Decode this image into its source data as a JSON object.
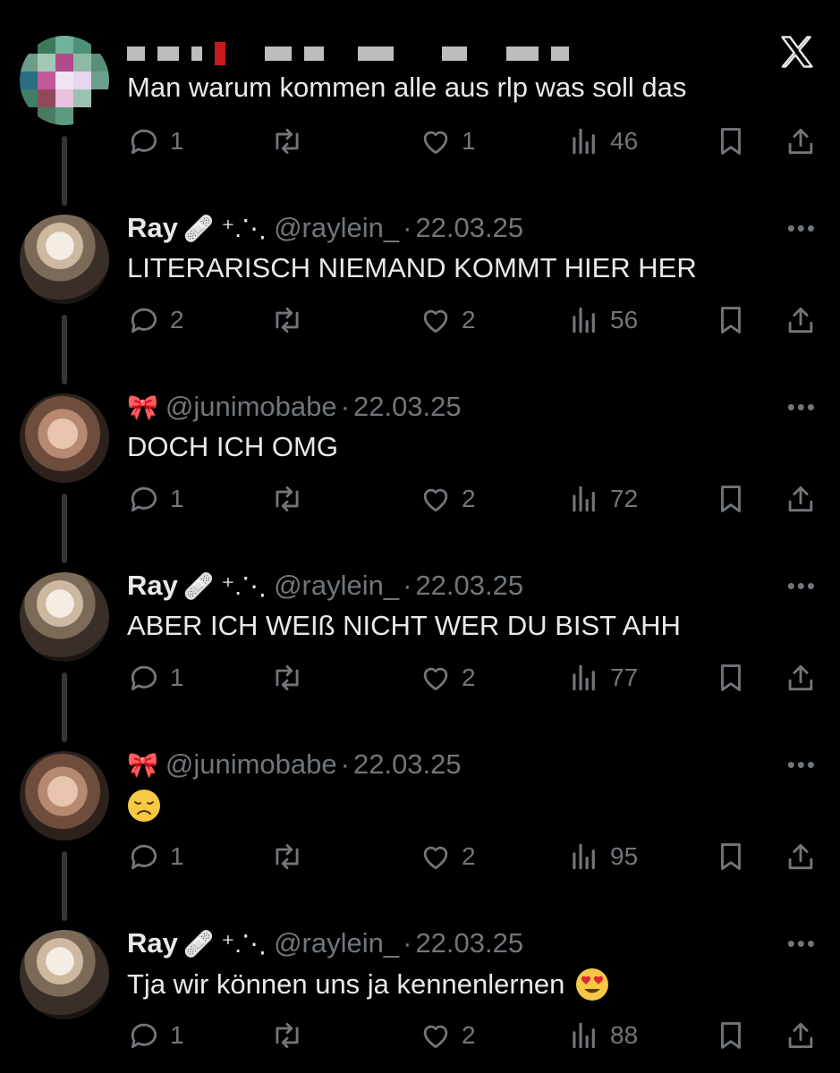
{
  "header": {
    "logo": "x-icon"
  },
  "tweets": [
    {
      "display_name": "",
      "handle": "",
      "date": "",
      "text": "Man warum kommen alle aus rlp was soll das",
      "name_redacted": true,
      "avatar": "pixelated-avatar",
      "stats": {
        "replies": "1",
        "retweets": "",
        "likes": "1",
        "views": "46"
      }
    },
    {
      "display_name": "Ray",
      "deco": "🩹 ⁺.⋱",
      "handle": "@raylein_",
      "sep": "·",
      "date": "22.03.25",
      "text": "LITERARISCH NIEMAND KOMMT HIER HER",
      "avatar": "ray-avatar",
      "stats": {
        "replies": "2",
        "retweets": "",
        "likes": "2",
        "views": "56"
      }
    },
    {
      "display_name": "",
      "deco": "🎀",
      "handle": "@junimobabe",
      "sep": "·",
      "date": "22.03.25",
      "text": "DOCH ICH OMG",
      "avatar": "junimobabe-avatar",
      "stats": {
        "replies": "1",
        "retweets": "",
        "likes": "2",
        "views": "72"
      }
    },
    {
      "display_name": "Ray",
      "deco": "🩹 ⁺.⋱",
      "handle": "@raylein_",
      "sep": "·",
      "date": "22.03.25",
      "text": "ABER ICH WEIß NICHT WER DU BIST AHH",
      "avatar": "ray-avatar",
      "stats": {
        "replies": "1",
        "retweets": "",
        "likes": "2",
        "views": "77"
      }
    },
    {
      "display_name": "",
      "deco": "🎀",
      "handle": "@junimobabe",
      "sep": "·",
      "date": "22.03.25",
      "text": "",
      "emoji": "disappointed-face",
      "avatar": "junimobabe-avatar",
      "stats": {
        "replies": "1",
        "retweets": "",
        "likes": "2",
        "views": "95"
      }
    },
    {
      "display_name": "Ray",
      "deco": "🩹 ⁺.⋱",
      "handle": "@raylein_",
      "sep": "·",
      "date": "22.03.25",
      "text": "Tja wir können uns ja kennenlernen",
      "emoji": "heart-eyes-face",
      "avatar": "ray-avatar",
      "stats": {
        "replies": "1",
        "retweets": "",
        "likes": "2",
        "views": "88"
      }
    }
  ],
  "more_label": "•••",
  "colors": {
    "background": "#000000",
    "text": "#e7e9ea",
    "muted": "#71767b",
    "connector": "#333639"
  }
}
